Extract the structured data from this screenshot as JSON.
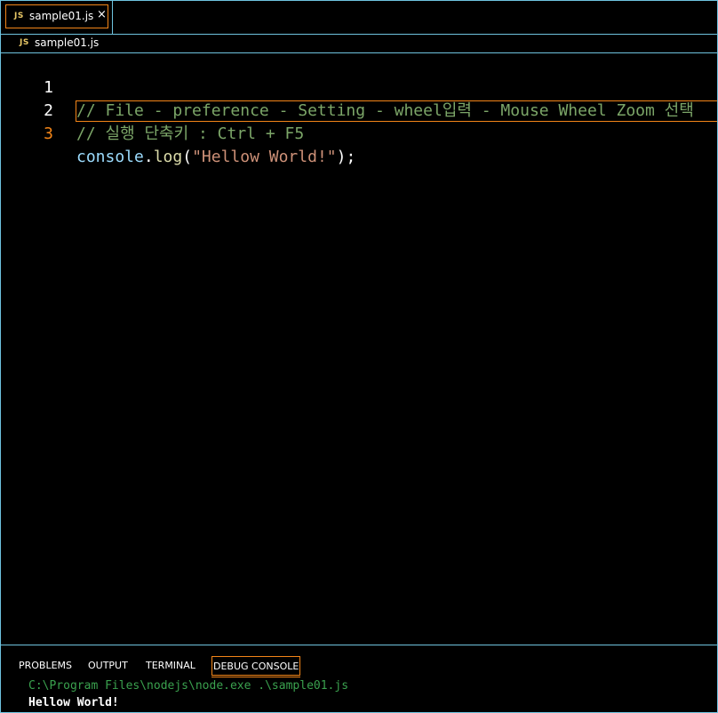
{
  "tabs": [
    {
      "icon": "JS",
      "label": "sample01.js",
      "close": "×",
      "active": true
    }
  ],
  "breadcrumb": {
    "icon": "JS",
    "label": "sample01.js"
  },
  "editor": {
    "active_line": 3,
    "lines": [
      {
        "number": "1",
        "text": "// File - preference - Setting - wheel입력 - Mouse Wheel Zoom 선택"
      },
      {
        "number": "2",
        "text": "// 실행 단축키 : Ctrl + F5"
      },
      {
        "number": "3",
        "tokens": {
          "object": "console",
          "dot": ".",
          "method": "log",
          "open": "(",
          "string": "\"Hellow World!\"",
          "close": ");"
        }
      }
    ]
  },
  "panel": {
    "tabs": [
      {
        "label": "PROBLEMS",
        "active": false
      },
      {
        "label": "OUTPUT",
        "active": false
      },
      {
        "label": "TERMINAL",
        "active": false
      },
      {
        "label": "DEBUG CONSOLE",
        "active": true
      }
    ],
    "console": {
      "command": "C:\\Program Files\\nodejs\\node.exe .\\sample01.js",
      "output": "Hellow World!"
    }
  },
  "colors": {
    "border": "#6fc3df",
    "focus_border": "#f38518",
    "comment": "#7ca668",
    "string": "#ce9178",
    "variable": "#9cdcfe",
    "function": "#dcdcaa",
    "console_command": "#3aa14e"
  }
}
